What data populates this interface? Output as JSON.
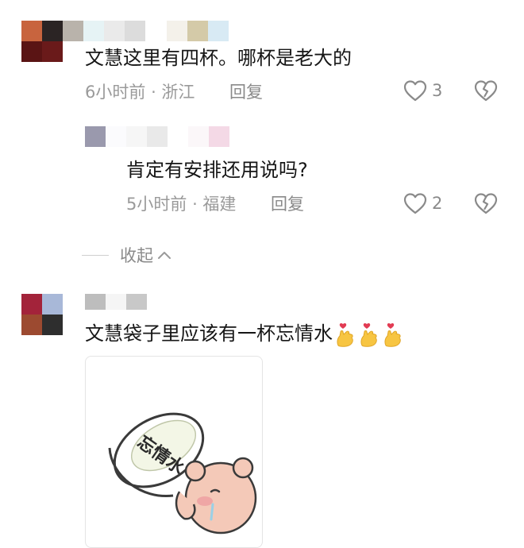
{
  "comments": [
    {
      "text": "文慧这里有四杯。哪杯是老大的",
      "time": "6小时前",
      "location": "浙江",
      "reply_label": "回复",
      "likes": "3"
    },
    {
      "text": "肯定有安排还用说吗?",
      "time": "5小时前",
      "location": "福建",
      "reply_label": "回复",
      "likes": "2"
    },
    {
      "text": "文慧袋子里应该有一杯忘情水"
    }
  ],
  "collapse_label": "收起",
  "sticker": {
    "bowl_text": "忘情水"
  },
  "colors": {
    "text": "#161616",
    "meta": "#9a9a9a",
    "icon": "#8a8a8a"
  }
}
